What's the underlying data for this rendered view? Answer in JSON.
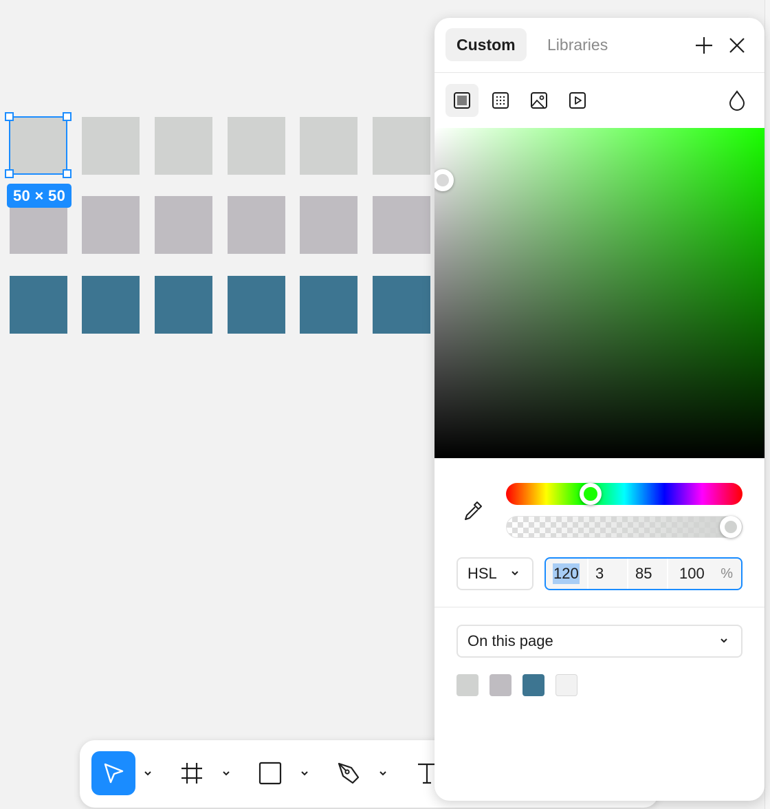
{
  "canvas": {
    "selection_size": "50 × 50",
    "rows": [
      {
        "color": "#d0d2d0",
        "count": 6
      },
      {
        "color": "#bfbcc1",
        "count": 6
      },
      {
        "color": "#3d7591",
        "count": 6
      }
    ]
  },
  "color_panel": {
    "tabs": [
      {
        "label": "Custom",
        "active": true
      },
      {
        "label": "Libraries",
        "active": false
      }
    ],
    "fill_types": [
      "solid-fill-icon",
      "gradient-fill-icon",
      "image-fill-icon",
      "video-fill-icon"
    ],
    "hue_color": "#1aff00",
    "color_mode": "HSL",
    "values": {
      "h": "120",
      "s": "3",
      "l": "85",
      "a": "100",
      "unit": "%"
    },
    "hue_degrees": 120,
    "opacity_percent": 100,
    "swatch_source": "On this page",
    "swatches": [
      "#d0d2d0",
      "#bfbcc1",
      "#3d7591",
      "#f2f2f2"
    ]
  },
  "toolbar": {
    "tools": [
      "move-tool",
      "frame-tool",
      "shape-tool",
      "pen-tool",
      "text-tool"
    ],
    "accent": "#1a8cff"
  }
}
